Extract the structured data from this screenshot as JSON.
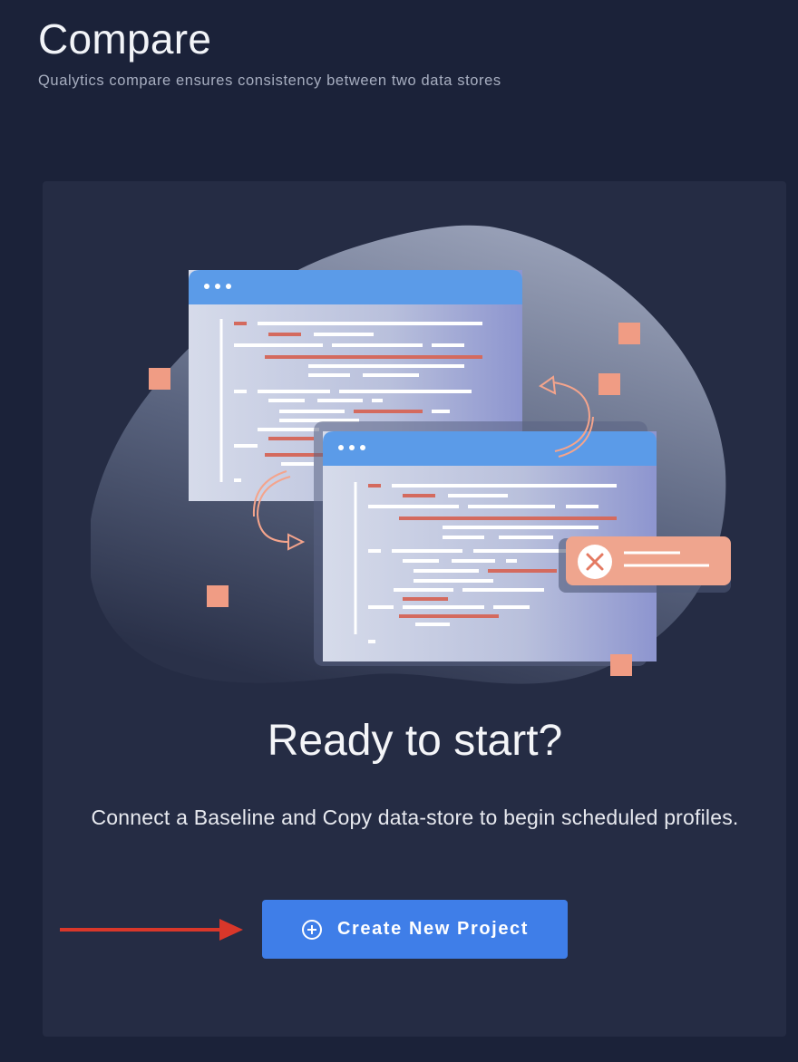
{
  "header": {
    "title": "Compare",
    "subtitle": "Qualytics compare ensures consistency between two data stores"
  },
  "empty_state": {
    "heading": "Ready to start?",
    "description": "Connect a Baseline and Copy data-store to begin scheduled profiles.",
    "button_label": "Create New Project",
    "button_icon": "plus-circle-icon",
    "pointer_icon": "red-arrow-icon"
  },
  "colors": {
    "background": "#1b2239",
    "card": "#252c44",
    "button": "#3f7ee8",
    "accent_orange": "#f09c84",
    "arrow_red": "#d9372a"
  }
}
